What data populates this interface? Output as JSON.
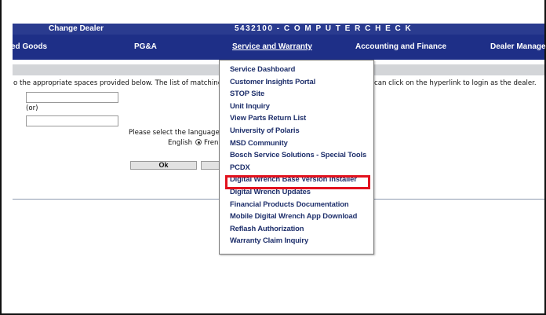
{
  "header": {
    "change_dealer": "Change Dealer",
    "company": "5432100 - C O M P U T E R C H E C K"
  },
  "nav": {
    "items": [
      {
        "label": "ed Goods"
      },
      {
        "label": "PG&A"
      },
      {
        "label": "Service and Warranty"
      },
      {
        "label": "Accounting and Finance"
      },
      {
        "label": "Dealer Managemen"
      }
    ]
  },
  "main": {
    "instruction_left": "o the appropriate spaces provided below. The list of matching d",
    "instruction_right": "can click on the hyperlink to login as the dealer.",
    "field1_value": "",
    "or_label": "(or)",
    "field2_value": "",
    "language_prompt": "Please select the language i",
    "lang_english": "English",
    "lang_french": "Fren",
    "ok_label": "Ok"
  },
  "dropdown": {
    "items": [
      "Service Dashboard",
      "Customer Insights Portal",
      "STOP Site",
      "Unit Inquiry",
      "View Parts Return List",
      "University of Polaris",
      "MSD Community",
      "Bosch Service Solutions - Special Tools",
      "PCDX",
      "Digital Wrench Base Version Installer",
      "Digital Wrench Updates",
      "Financial Products Documentation",
      "Mobile Digital Wrench App Download",
      "Reflash Authorization",
      "Warranty Claim Inquiry"
    ],
    "highlighted_index": 9,
    "highlight_color": "#e2121e"
  },
  "colors": {
    "title_bar": "#2a3b8f",
    "nav_bar": "#1e2f87",
    "sub_bar": "#d3d5d8"
  }
}
